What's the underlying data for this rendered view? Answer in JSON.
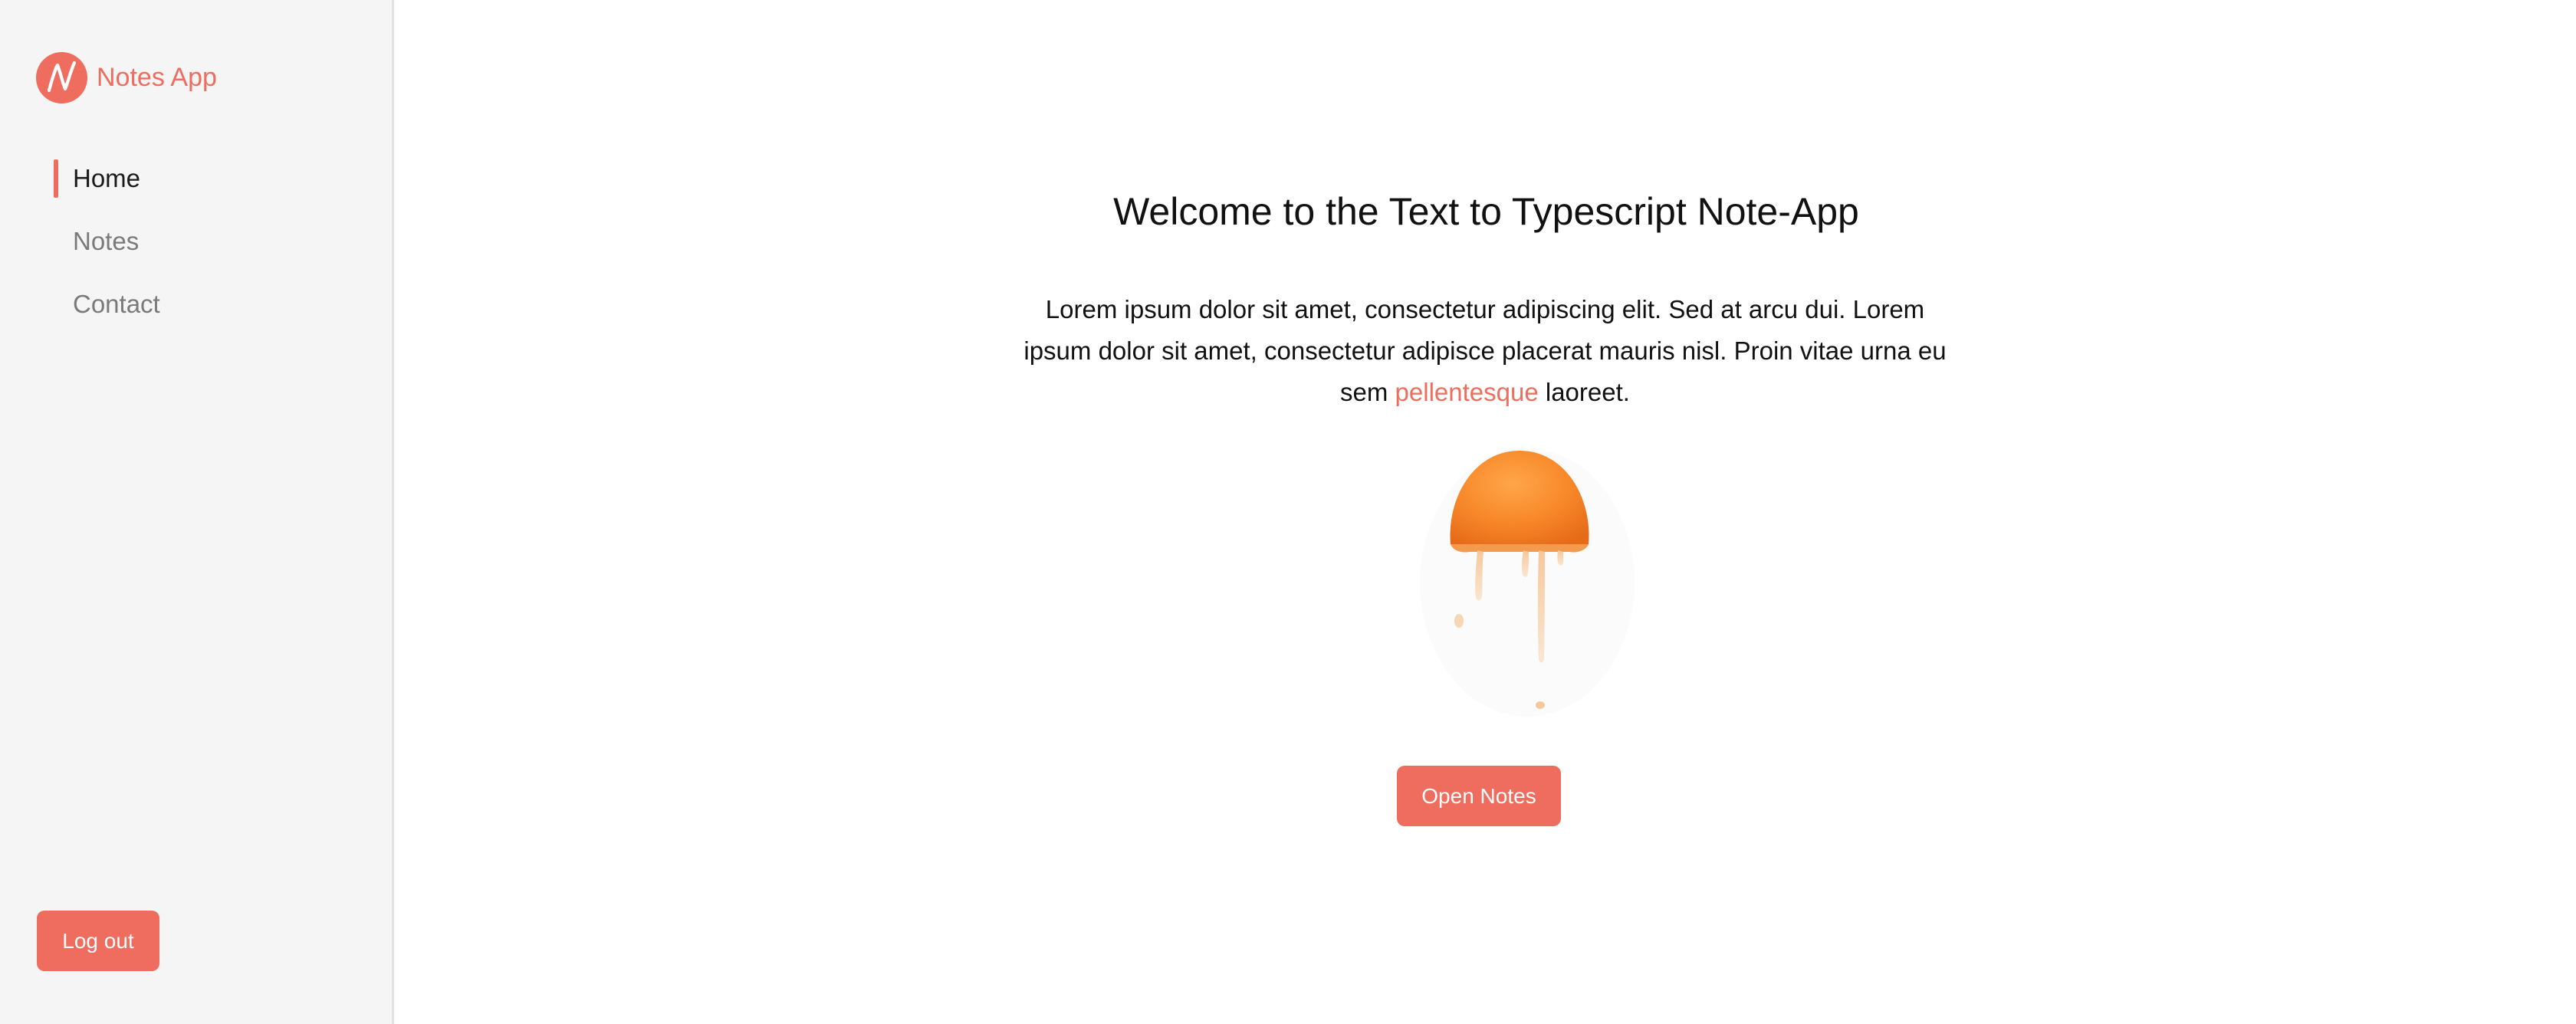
{
  "brand": {
    "name": "Notes App",
    "logo_letter": "N",
    "accent_color": "#ee6d5e"
  },
  "sidebar": {
    "items": [
      {
        "label": "Home",
        "active": true
      },
      {
        "label": "Notes",
        "active": false
      },
      {
        "label": "Contact",
        "active": false
      }
    ],
    "logout_label": "Log out"
  },
  "main": {
    "title": "Welcome to the Text to Typescript Note-App",
    "intro_before": "Lorem ipsum dolor sit amet, consectetur adipiscing elit. Sed at arcu dui. Lorem ipsum dolor sit amet, consectetur adipisce placerat mauris nisl. Proin vitae urna eu sem ",
    "intro_link": "pellentesque",
    "intro_after": " laoreet.",
    "hero_image": "dripping-orange-half",
    "open_notes_label": "Open Notes"
  }
}
